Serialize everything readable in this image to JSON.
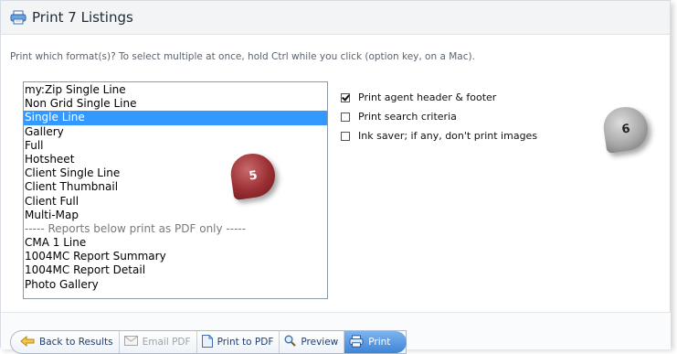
{
  "dialog": {
    "title": "Print 7 Listings",
    "instructions": "Print which format(s)? To select multiple at once, hold Ctrl while you click (option key, on a Mac)."
  },
  "formats": [
    {
      "label": "my:Zip Single Line",
      "selected": false
    },
    {
      "label": "Non Grid Single Line",
      "selected": false
    },
    {
      "label": "Single Line",
      "selected": true
    },
    {
      "label": "Gallery",
      "selected": false
    },
    {
      "label": "Full",
      "selected": false
    },
    {
      "label": "Hotsheet",
      "selected": false
    },
    {
      "label": "Client Single Line",
      "selected": false
    },
    {
      "label": "Client Thumbnail",
      "selected": false
    },
    {
      "label": "Client Full",
      "selected": false
    },
    {
      "label": "Multi-Map",
      "selected": false
    },
    {
      "label": "----- Reports below print as PDF only -----",
      "selected": false,
      "separator": true
    },
    {
      "label": "CMA 1 Line",
      "selected": false
    },
    {
      "label": "1004MC Report Summary",
      "selected": false
    },
    {
      "label": "1004MC Report Detail",
      "selected": false
    },
    {
      "label": "Photo Gallery",
      "selected": false
    }
  ],
  "options": [
    {
      "label": "Print agent header & footer",
      "checked": true
    },
    {
      "label": "Print search criteria",
      "checked": false
    },
    {
      "label": "Ink saver; if any, don't print images",
      "checked": false
    }
  ],
  "badges": {
    "left": "5",
    "right": "6"
  },
  "toolbar": {
    "back_label": "Back to Results",
    "email_pdf_label": "Email PDF",
    "print_to_pdf_label": "Print to PDF",
    "preview_label": "Preview",
    "print_label": "Print"
  },
  "colors": {
    "selection": "#3399ff",
    "primary_button": "#3f84d6",
    "badge_5": "#9a2f33",
    "badge_6": "#a9a9a9"
  }
}
